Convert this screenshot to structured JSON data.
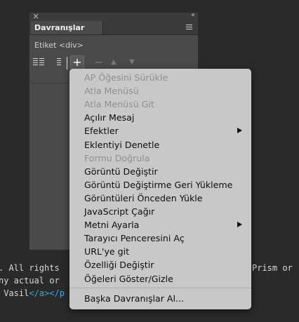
{
  "code": {
    "line1_left": ". All rights",
    "line1_right": "Prism or",
    "line2_left": "ny actual or",
    "line3_text": " Vasil",
    "line3_tag": "</a></p"
  },
  "panel": {
    "tab_label": "Davranışlar",
    "tag_label": "Etiket <div>",
    "add_label": "+",
    "minus_label": "−",
    "up_label": "▲",
    "down_label": "▼",
    "close_label": "×",
    "collapse_label": "‹‹"
  },
  "menu": {
    "items": [
      {
        "label": "AP Öğesini Sürükle",
        "enabled": false
      },
      {
        "label": "Atla Menüsü",
        "enabled": false
      },
      {
        "label": "Atla Menüsü Git",
        "enabled": false
      },
      {
        "label": "Açılır Mesaj",
        "enabled": true
      },
      {
        "label": "Efektler",
        "enabled": true,
        "submenu": true
      },
      {
        "label": "Eklentiyi Denetle",
        "enabled": true
      },
      {
        "label": "Formu Doğrula",
        "enabled": false
      },
      {
        "label": "Görüntü Değiştir",
        "enabled": true
      },
      {
        "label": "Görüntü Değiştirme Geri Yükleme",
        "enabled": true
      },
      {
        "label": "Görüntüleri Önceden Yükle",
        "enabled": true
      },
      {
        "label": "JavaScript Çağır",
        "enabled": true
      },
      {
        "label": "Metni Ayarla",
        "enabled": true,
        "submenu": true
      },
      {
        "label": "Tarayıcı Penceresini Aç",
        "enabled": true
      },
      {
        "label": "URL'ye git",
        "enabled": true
      },
      {
        "label": "Özelliği Değiştir",
        "enabled": true
      },
      {
        "label": "Öğeleri Göster/Gizle",
        "enabled": true
      }
    ],
    "footer_item": "Başka Davranışlar Al..."
  }
}
